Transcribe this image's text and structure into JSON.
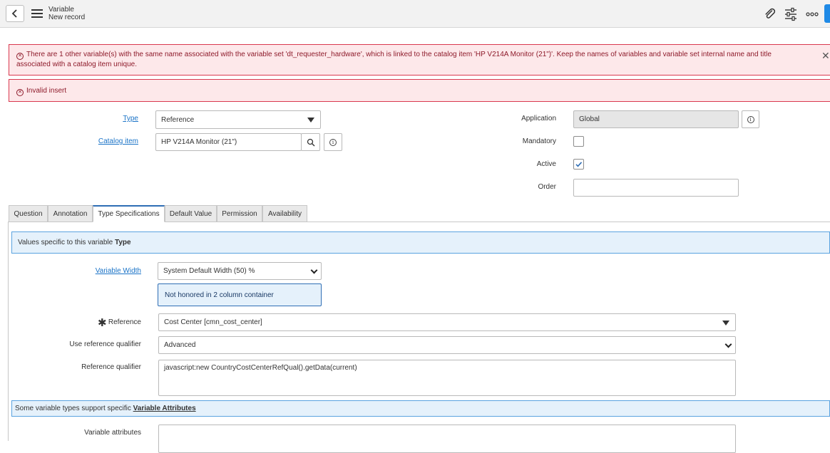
{
  "header": {
    "title": "Variable",
    "subtitle": "New record",
    "icons": [
      "back-icon",
      "menu-icon",
      "paperclip-icon",
      "sliders-icon",
      "more-icon"
    ]
  },
  "alerts": {
    "duplicate": "There are 1 other variable(s) with the same name associated with the variable set 'dt_requester_hardware', which is linked to the catalog item 'HP V214A Monitor (21\")'. Keep the names of variables and variable set internal name and title associated with a catalog item unique.",
    "invalid": "Invalid insert",
    "close_glyph": "✕",
    "icon_glyph": "✕"
  },
  "form": {
    "type_label": "Type",
    "type_value": "Reference",
    "catalog_item_label": "Catalog item",
    "catalog_item_value": "HP V214A Monitor (21\")",
    "application_label": "Application",
    "application_value": "Global",
    "mandatory_label": "Mandatory",
    "mandatory_checked": false,
    "active_label": "Active",
    "active_checked": true,
    "order_label": "Order",
    "order_value": ""
  },
  "tabs": [
    {
      "label": "Question",
      "active": false
    },
    {
      "label": "Annotation",
      "active": false
    },
    {
      "label": "Type Specifications",
      "active": true
    },
    {
      "label": "Default Value",
      "active": false
    },
    {
      "label": "Permission",
      "active": false
    },
    {
      "label": "Availability",
      "active": false
    }
  ],
  "type_spec": {
    "info_prefix": "Values specific to this variable",
    "info_bold": "Type",
    "width_label": "Variable Width",
    "width_value": "System Default Width (50) %",
    "width_note": "Not honored in 2 column container",
    "reference_label": "Reference",
    "reference_required_glyph": "✱",
    "reference_value": "Cost Center [cmn_cost_center]",
    "use_qualifier_label": "Use reference qualifier",
    "use_qualifier_value": "Advanced",
    "qualifier_label": "Reference qualifier",
    "qualifier_value": "javascript:new CountryCostCenterRefQual().getData(current)",
    "attr_info_prefix": "Some variable types support specific",
    "attr_info_link": "Variable Attributes",
    "attributes_label": "Variable attributes",
    "attributes_value": ""
  },
  "colors": {
    "error_bg": "#fde8ea",
    "error_border": "#d9394f",
    "link": "#1a73c7",
    "info_bg": "#e5f1fb",
    "accent": "#1f8ae6"
  }
}
